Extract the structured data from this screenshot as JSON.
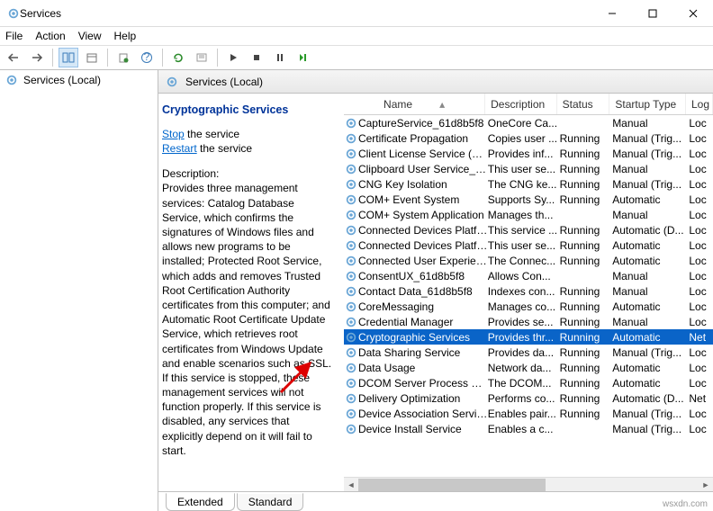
{
  "window": {
    "title": "Services"
  },
  "menu": {
    "file": "File",
    "action": "Action",
    "view": "View",
    "help": "Help"
  },
  "left": {
    "title": "Services (Local)"
  },
  "header": {
    "title": "Services (Local)"
  },
  "detail": {
    "title": "Cryptographic Services",
    "stop_link": "Stop",
    "stop_rest": " the service",
    "restart_link": "Restart",
    "restart_rest": " the service",
    "desc_label": "Description:",
    "desc": "Provides three management services: Catalog Database Service, which confirms the signatures of Windows files and allows new programs to be installed; Protected Root Service, which adds and removes Trusted Root Certification Authority certificates from this computer; and Automatic Root Certificate Update Service, which retrieves root certificates from Windows Update and enable scenarios such as SSL. If this service is stopped, these management services will not function properly. If this service is disabled, any services that explicitly depend on it will fail to start."
  },
  "columns": {
    "name": "Name",
    "description": "Description",
    "status": "Status",
    "startup": "Startup Type",
    "logon": "Log"
  },
  "services": [
    {
      "name": "CaptureService_61d8b5f8",
      "desc": "OneCore Ca...",
      "status": "",
      "startup": "Manual",
      "log": "Loc"
    },
    {
      "name": "Certificate Propagation",
      "desc": "Copies user ...",
      "status": "Running",
      "startup": "Manual (Trig...",
      "log": "Loc"
    },
    {
      "name": "Client License Service (ClipS...",
      "desc": "Provides inf...",
      "status": "Running",
      "startup": "Manual (Trig...",
      "log": "Loc"
    },
    {
      "name": "Clipboard User Service_61d...",
      "desc": "This user se...",
      "status": "Running",
      "startup": "Manual",
      "log": "Loc"
    },
    {
      "name": "CNG Key Isolation",
      "desc": "The CNG ke...",
      "status": "Running",
      "startup": "Manual (Trig...",
      "log": "Loc"
    },
    {
      "name": "COM+ Event System",
      "desc": "Supports Sy...",
      "status": "Running",
      "startup": "Automatic",
      "log": "Loc"
    },
    {
      "name": "COM+ System Application",
      "desc": "Manages th...",
      "status": "",
      "startup": "Manual",
      "log": "Loc"
    },
    {
      "name": "Connected Devices Platfor...",
      "desc": "This service ...",
      "status": "Running",
      "startup": "Automatic (D...",
      "log": "Loc"
    },
    {
      "name": "Connected Devices Platfor...",
      "desc": "This user se...",
      "status": "Running",
      "startup": "Automatic",
      "log": "Loc"
    },
    {
      "name": "Connected User Experience...",
      "desc": "The Connec...",
      "status": "Running",
      "startup": "Automatic",
      "log": "Loc"
    },
    {
      "name": "ConsentUX_61d8b5f8",
      "desc": "Allows Con...",
      "status": "",
      "startup": "Manual",
      "log": "Loc"
    },
    {
      "name": "Contact Data_61d8b5f8",
      "desc": "Indexes con...",
      "status": "Running",
      "startup": "Manual",
      "log": "Loc"
    },
    {
      "name": "CoreMessaging",
      "desc": "Manages co...",
      "status": "Running",
      "startup": "Automatic",
      "log": "Loc"
    },
    {
      "name": "Credential Manager",
      "desc": "Provides se...",
      "status": "Running",
      "startup": "Manual",
      "log": "Loc"
    },
    {
      "name": "Cryptographic Services",
      "desc": "Provides thr...",
      "status": "Running",
      "startup": "Automatic",
      "log": "Net",
      "selected": true
    },
    {
      "name": "Data Sharing Service",
      "desc": "Provides da...",
      "status": "Running",
      "startup": "Manual (Trig...",
      "log": "Loc"
    },
    {
      "name": "Data Usage",
      "desc": "Network da...",
      "status": "Running",
      "startup": "Automatic",
      "log": "Loc"
    },
    {
      "name": "DCOM Server Process Laun...",
      "desc": "The DCOM...",
      "status": "Running",
      "startup": "Automatic",
      "log": "Loc"
    },
    {
      "name": "Delivery Optimization",
      "desc": "Performs co...",
      "status": "Running",
      "startup": "Automatic (D...",
      "log": "Net"
    },
    {
      "name": "Device Association Service",
      "desc": "Enables pair...",
      "status": "Running",
      "startup": "Manual (Trig...",
      "log": "Loc"
    },
    {
      "name": "Device Install Service",
      "desc": "Enables a c...",
      "status": "",
      "startup": "Manual (Trig...",
      "log": "Loc"
    }
  ],
  "tabs": {
    "extended": "Extended",
    "standard": "Standard"
  },
  "watermark": "wsxdn.com"
}
